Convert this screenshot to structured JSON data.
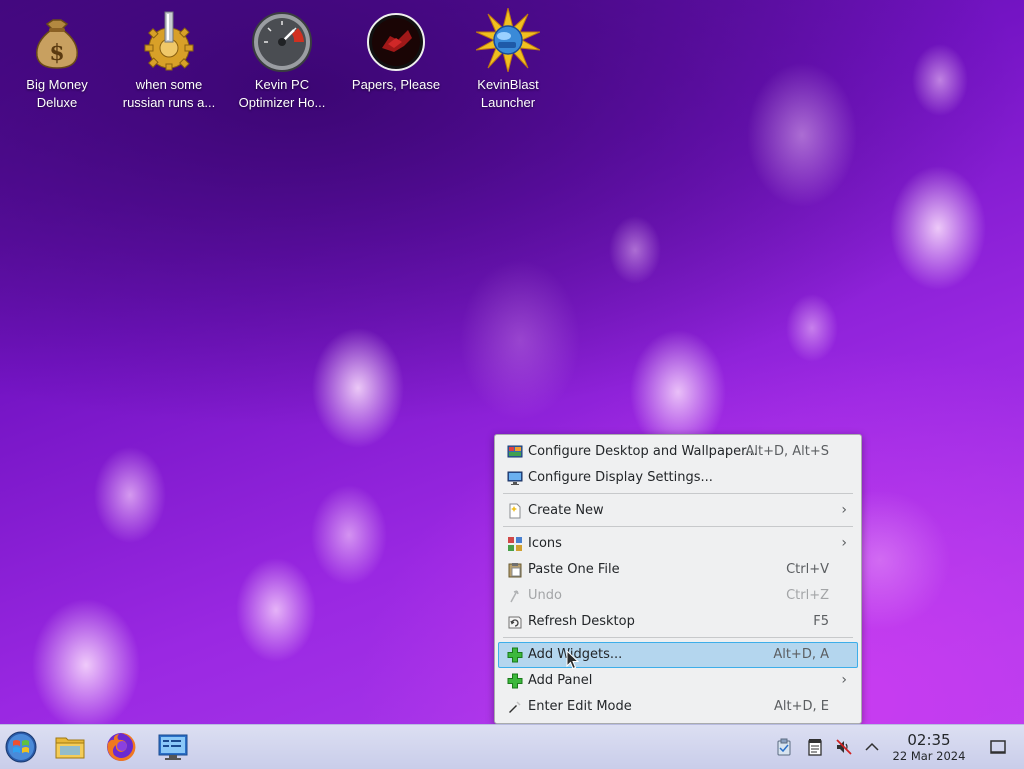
{
  "desktop": {
    "icons": [
      {
        "label": "Big Money\nDeluxe",
        "icon": "money-bag-icon"
      },
      {
        "label": "when some\nrussian runs a...",
        "icon": "gear-icon"
      },
      {
        "label": "Kevin PC\nOptimizer Ho...",
        "icon": "speedometer-icon"
      },
      {
        "label": "Papers, Please",
        "icon": "papers-please-icon"
      },
      {
        "label": "KevinBlast\nLauncher",
        "icon": "starburst-icon"
      }
    ]
  },
  "context_menu": {
    "items": [
      {
        "label": "Configure Desktop and Wallpaper...",
        "shortcut": "Alt+D, Alt+S",
        "icon": "desktop-settings-icon"
      },
      {
        "label": "Configure Display Settings...",
        "shortcut": "",
        "icon": "display-icon"
      },
      {
        "label": "Create New",
        "shortcut": "",
        "icon": "new-file-icon",
        "submenu": true
      },
      {
        "label": "Icons",
        "shortcut": "",
        "icon": "icons-grid-icon",
        "submenu": true
      },
      {
        "label": "Paste One File",
        "shortcut": "Ctrl+V",
        "icon": "paste-icon"
      },
      {
        "label": "Undo",
        "shortcut": "Ctrl+Z",
        "icon": "undo-icon",
        "disabled": true
      },
      {
        "label": "Refresh Desktop",
        "shortcut": "F5",
        "icon": "refresh-icon"
      },
      {
        "label": "Add Widgets...",
        "shortcut": "Alt+D, A",
        "icon": "plus-icon",
        "highlighted": true
      },
      {
        "label": "Add Panel",
        "shortcut": "",
        "icon": "plus-icon",
        "submenu": true
      },
      {
        "label": "Enter Edit Mode",
        "shortcut": "Alt+D, E",
        "icon": "edit-mode-icon"
      }
    ],
    "submenu_arrow": "›"
  },
  "taskbar": {
    "launchers": [
      "start-menu-icon",
      "file-manager-icon",
      "firefox-icon",
      "system-settings-icon"
    ],
    "tray": [
      "clipboard-icon",
      "notes-icon",
      "volume-muted-icon",
      "chevron-up-icon"
    ],
    "clock": {
      "time": "02:35",
      "date": "22 Mar 2024"
    },
    "show_desktop": "show-desktop-icon"
  }
}
